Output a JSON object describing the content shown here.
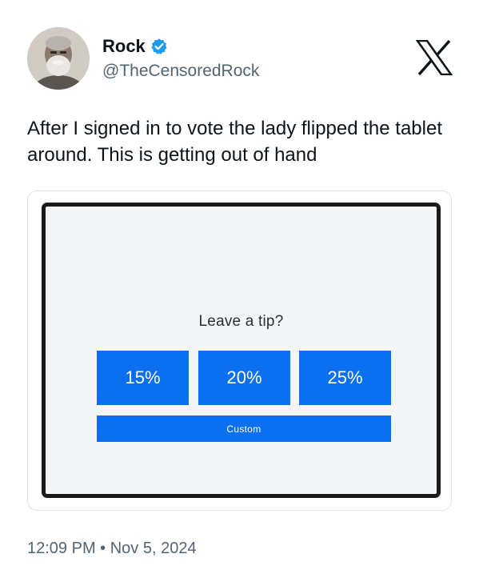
{
  "author": {
    "display_name": "Rock",
    "handle": "@TheCensoredRock",
    "verified": true,
    "avatar_icon": "profile-photo-bearded-man"
  },
  "platform_logo": "x-logo-icon",
  "tweet": {
    "text": "After I signed in to vote the lady flipped the tablet around. This is getting out of hand",
    "timestamp": "12:09 PM • Nov 5, 2024"
  },
  "media": {
    "prompt": "Leave a tip?",
    "tip_options": [
      "15%",
      "20%",
      "25%"
    ],
    "custom_label": "Custom",
    "button_color": "#0a6ff0"
  },
  "colors": {
    "verified_badge": "#1d9bf0",
    "secondary_text": "#536471",
    "primary_text": "#0f1419"
  }
}
